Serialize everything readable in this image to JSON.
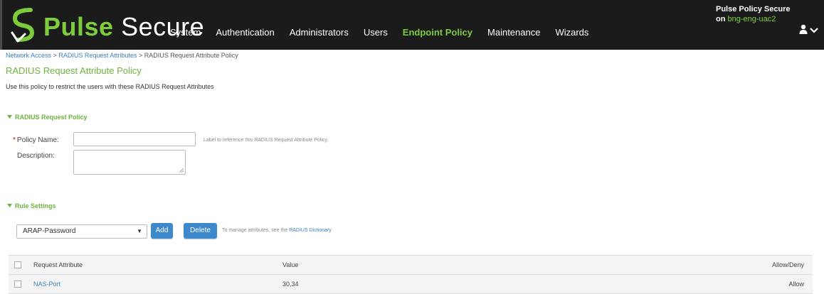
{
  "header": {
    "brand_pulse": "Pulse",
    "brand_secure": "Secure",
    "nav": [
      "System",
      "Authentication",
      "Administrators",
      "Users",
      "Endpoint Policy",
      "Maintenance",
      "Wizards"
    ],
    "active_nav": "Endpoint Policy",
    "product_name": "Pulse Policy Secure",
    "product_on": "on",
    "host": "bng-eng-uac2",
    "user_icon": "user-icon",
    "menu_icon": "chevron-down-icon"
  },
  "breadcrumb": {
    "items": [
      "Network Access",
      "RADIUS Request Attributes",
      "RADIUS Request Attribute Policy"
    ],
    "separator": ">"
  },
  "page": {
    "title": "RADIUS Request Attribute Policy",
    "intro": "Use this policy to restrict the users with these RADIUS Request Attributes"
  },
  "policy_section": {
    "heading": "RADIUS Request Policy",
    "policy_name_label": "Policy Name:",
    "required_mark": "*",
    "policy_name_value": "",
    "policy_name_hint": "Label to reference this RADIUS Request Attribute Policy.",
    "description_label": "Description:",
    "description_value": ""
  },
  "rule_section": {
    "heading": "Rule Settings",
    "attribute_selected": "ARAP-Password",
    "add_label": "Add",
    "delete_label": "Delete",
    "manage_text": "To manage attributes, see the",
    "manage_link": "RADIUS Dictionary"
  },
  "table": {
    "columns": [
      "Request Attribute",
      "Value",
      "Allow/Deny"
    ],
    "rows": [
      {
        "attribute": "NAS-Port",
        "value": "30,34",
        "allow_deny": "Allow"
      }
    ]
  },
  "colors": {
    "header_bg": "#1b1b1b",
    "brand_green": "#7dcc3c",
    "link_blue": "#3a7fbf",
    "button_blue": "#3e89cc"
  }
}
